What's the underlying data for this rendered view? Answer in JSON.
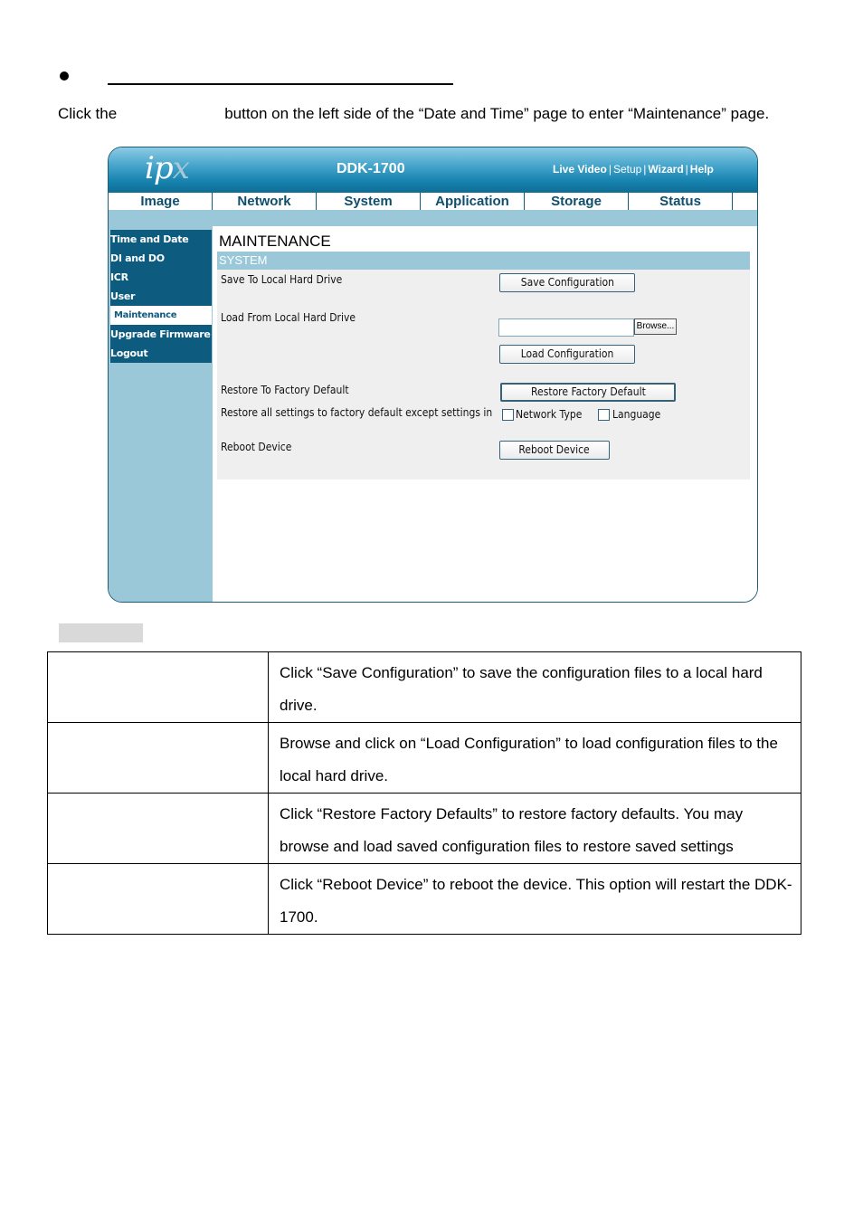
{
  "intro": {
    "prefix": "Click the",
    "suffix": "button on the left side of the “Date and Time” page to enter “Maintenance” page."
  },
  "ui": {
    "logo": {
      "main": "ip",
      "accent": "x"
    },
    "model": "DDK-1700",
    "top_links": [
      "Live Video",
      "Setup",
      "Wizard",
      "Help"
    ],
    "tabs": [
      "Image",
      "Network",
      "System",
      "Application",
      "Storage",
      "Status"
    ],
    "sidebar": [
      {
        "label": "Time and Date",
        "active": false
      },
      {
        "label": "DI and DO",
        "active": false
      },
      {
        "label": "ICR",
        "active": false
      },
      {
        "label": "User",
        "active": false
      },
      {
        "label": "Maintenance",
        "active": true
      },
      {
        "label": "Upgrade Firmware",
        "active": false
      },
      {
        "label": "Logout",
        "active": false
      }
    ],
    "page_title": "MAINTENANCE",
    "section_title": "SYSTEM",
    "rows": {
      "save_label": "Save To Local Hard Drive",
      "save_button": "Save Configuration",
      "load_label": "Load From Local Hard Drive",
      "file_value": "",
      "browse_button": "Browse...",
      "load_button": "Load Configuration",
      "restore_label": "Restore To Factory Default",
      "restore_button": "Restore Factory Default",
      "restore_except_label": "Restore all settings to factory default except settings in",
      "chk_network_label": "Network Type",
      "chk_network_checked": false,
      "chk_language_label": "Language",
      "chk_language_checked": false,
      "reboot_label": "Reboot Device",
      "reboot_button": "Reboot Device"
    },
    "colors": {
      "header_blue": "#1784b0",
      "nav_dark": "#0d5b7e",
      "light_blue": "#9ac8d8",
      "section_bg": "#efefef"
    }
  },
  "table": {
    "rows": [
      {
        "item": "",
        "description": "Click “Save Configuration” to save the configuration files to a local hard drive."
      },
      {
        "item": "",
        "description": "Browse and click on “Load Configuration” to load configuration files to the local hard drive."
      },
      {
        "item": "",
        "description": "Click “Restore Factory Defaults” to restore factory defaults. You may browse and load saved configuration files to restore saved settings"
      },
      {
        "item": "",
        "description": "Click “Reboot Device” to reboot the device. This option will restart the DDK-1700."
      }
    ]
  }
}
